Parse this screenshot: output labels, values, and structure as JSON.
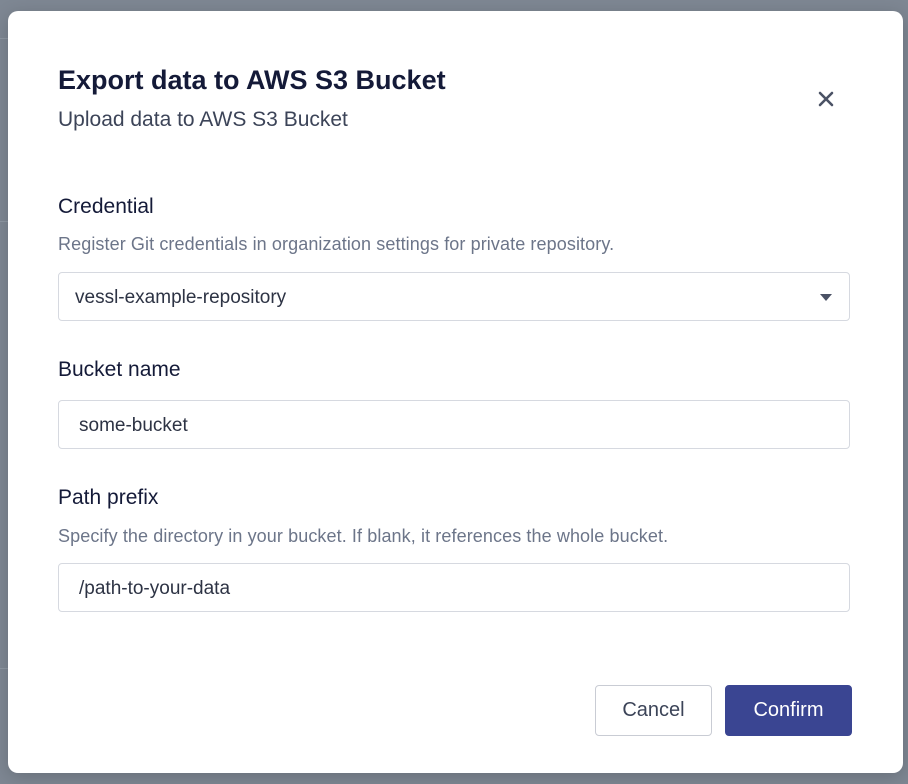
{
  "dialog": {
    "title": "Export data to AWS S3 Bucket",
    "subtitle": "Upload data to AWS S3 Bucket",
    "close_icon": "close-icon"
  },
  "credential": {
    "label": "Credential",
    "help": "Register Git credentials in organization settings for private repository.",
    "selected": "vessl-example-repository",
    "dropdown_icon": "caret-down-icon"
  },
  "bucket_name": {
    "label": "Bucket name",
    "value": "some-bucket"
  },
  "path_prefix": {
    "label": "Path prefix",
    "help": "Specify the directory in your bucket. If blank, it references the whole bucket.",
    "value": "/path-to-your-data"
  },
  "actions": {
    "cancel_label": "Cancel",
    "confirm_label": "Confirm"
  },
  "colors": {
    "backdrop": "#7e8793",
    "primary": "#3a4592",
    "title_text": "#141a38",
    "help_text": "#6c7589",
    "border": "#d6d9e0"
  }
}
